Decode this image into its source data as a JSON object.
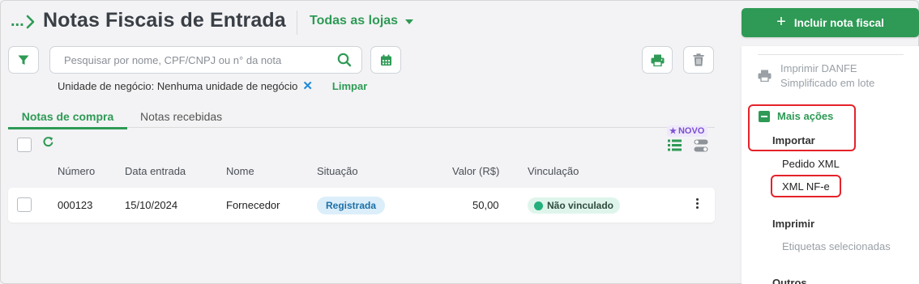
{
  "header": {
    "breadcrumb": "...",
    "title": "Notas Fiscais de Entrada",
    "store_selector": "Todas as lojas",
    "primary_action": "Incluir nota fiscal"
  },
  "toolbar": {
    "search_placeholder": "Pesquisar por nome, CPF/CNPJ ou n° da nota",
    "filter_chip": "Unidade de negócio: Nenhuma unidade de negócio",
    "clear_label": "Limpar"
  },
  "tabs": [
    {
      "label": "Notas de compra",
      "active": true
    },
    {
      "label": "Notas recebidas",
      "active": false
    }
  ],
  "badge_new": "NOVO",
  "table": {
    "columns": {
      "numero": "Número",
      "data": "Data entrada",
      "nome": "Nome",
      "situacao": "Situação",
      "valor": "Valor (R$)",
      "vinculacao": "Vinculação"
    },
    "rows": [
      {
        "numero": "000123",
        "data": "15/10/2024",
        "nome": "Fornecedor",
        "situacao": "Registrada",
        "valor": "50,00",
        "vinculacao": "Não vinculado"
      }
    ]
  },
  "side_menu": {
    "danfe_line1": "Imprimir DANFE",
    "danfe_line2": "Simplificado em lote",
    "more_actions": "Mais ações",
    "import_header": "Importar",
    "import_items": [
      "Pedido XML",
      "XML NF-e"
    ],
    "print_header": "Imprimir",
    "print_items": [
      "Etiquetas selecionadas"
    ],
    "others_header": "Outros"
  },
  "colors": {
    "brand_green": "#2e9a55",
    "highlight_red": "#e5222a",
    "status_blue_bg": "#dbeefa",
    "status_green_dot": "#22b07d"
  },
  "icons": [
    "chevron-right-icon",
    "caret-down-icon",
    "plus-icon",
    "filter-icon",
    "search-icon",
    "calendar-icon",
    "printer-icon",
    "trash-icon",
    "close-icon",
    "refresh-icon",
    "star-icon",
    "list-view-icon",
    "toggle-view-icon",
    "more-vertical-icon"
  ]
}
